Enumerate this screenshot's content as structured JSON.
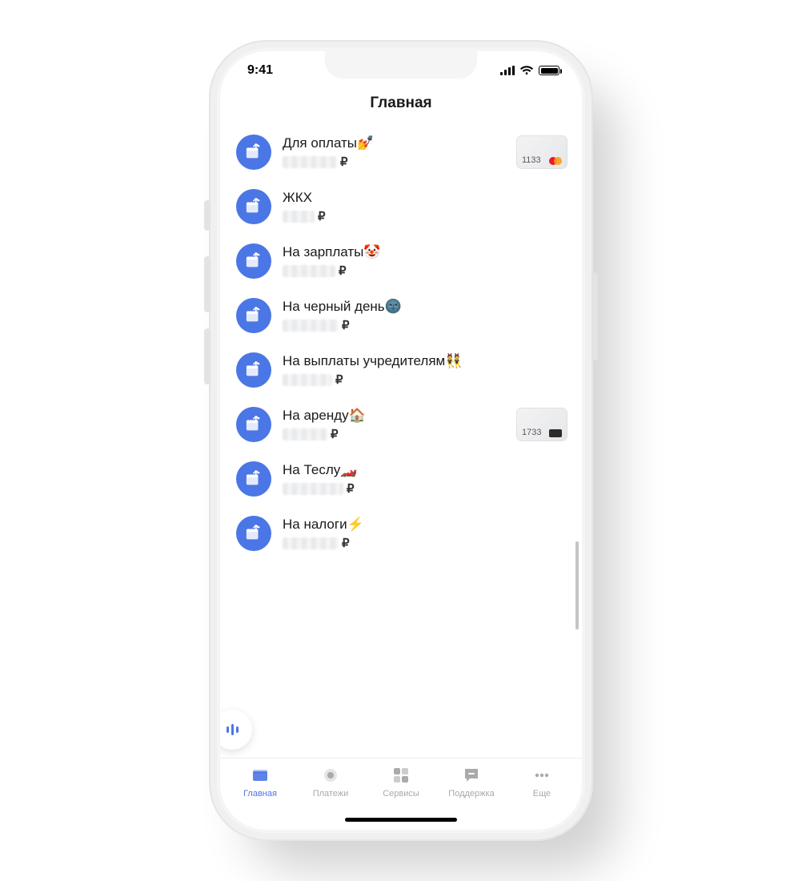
{
  "status": {
    "time": "9:41"
  },
  "header": {
    "title": "Главная"
  },
  "currency": "₽",
  "accounts": [
    {
      "title": "Для оплаты",
      "emoji": "💅",
      "blur_w": 68,
      "card": {
        "last4": "1133",
        "brand": "mastercard"
      }
    },
    {
      "title": "ЖКХ",
      "emoji": "",
      "blur_w": 40,
      "card": null
    },
    {
      "title": "На зарплаты",
      "emoji": "🤡",
      "blur_w": 66,
      "card": null
    },
    {
      "title": "На черный день",
      "emoji": "🌚",
      "blur_w": 70,
      "card": null
    },
    {
      "title": "На выплаты учредителям",
      "emoji": "👯",
      "blur_w": 62,
      "card": null
    },
    {
      "title": "На аренду",
      "emoji": "🏠",
      "blur_w": 56,
      "card": {
        "last4": "1733",
        "brand": "mir"
      }
    },
    {
      "title": "На Теслу",
      "emoji": "🏎️",
      "blur_w": 76,
      "card": null
    },
    {
      "title": "На налоги",
      "emoji": "⚡",
      "blur_w": 70,
      "card": null
    }
  ],
  "tabs": [
    {
      "id": "home",
      "label": "Главная",
      "active": true
    },
    {
      "id": "payments",
      "label": "Платежи",
      "active": false
    },
    {
      "id": "services",
      "label": "Сервисы",
      "active": false
    },
    {
      "id": "support",
      "label": "Поддержка",
      "active": false
    },
    {
      "id": "more",
      "label": "Еще",
      "active": false
    }
  ]
}
